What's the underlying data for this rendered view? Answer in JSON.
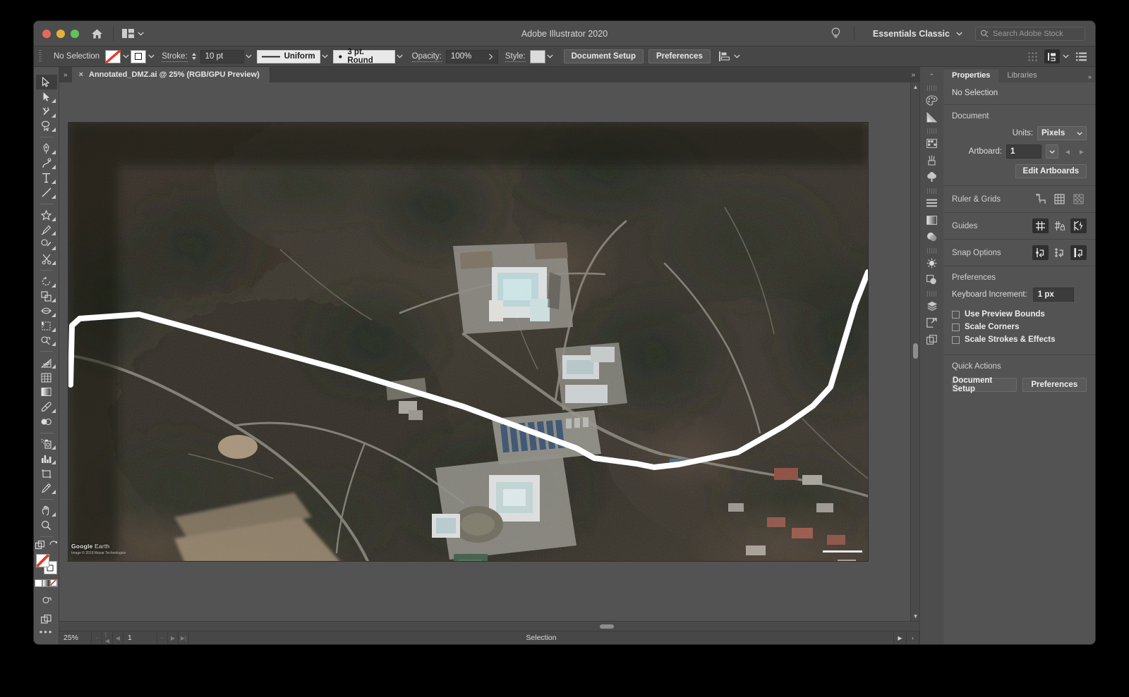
{
  "window": {
    "app_title": "Adobe Illustrator 2020",
    "workspace": "Essentials Classic",
    "search_placeholder": "Search Adobe Stock",
    "traffic_close": "close-window",
    "traffic_min": "minimize-window",
    "traffic_max": "maximize-window"
  },
  "control_bar": {
    "selection_status": "No Selection",
    "stroke_label": "Stroke:",
    "stroke_weight": "10 pt",
    "stroke_profile": "Uniform",
    "brush_definition": "3 pt. Round",
    "opacity_label": "Opacity:",
    "opacity_value": "100%",
    "style_label": "Style:",
    "document_setup": "Document Setup",
    "preferences": "Preferences"
  },
  "tab": {
    "title": "Annotated_DMZ.ai @ 25% (RGB/GPU Preview)",
    "close_glyph": "×"
  },
  "canvas": {
    "watermark_brand": "Google",
    "watermark_suffix": " Earth",
    "watermark_attr": "Image © 2019 Maxar Technologies"
  },
  "status_bar": {
    "zoom": "25%",
    "artboard_number": "1",
    "tool_status": "Selection"
  },
  "properties_panel": {
    "tabs": [
      "Properties",
      "Libraries"
    ],
    "active_tab": "Properties",
    "no_selection": "No Selection",
    "document_header": "Document",
    "units_label": "Units:",
    "units_value": "Pixels",
    "artboard_label": "Artboard:",
    "artboard_value": "1",
    "edit_artboards": "Edit Artboards",
    "ruler_grids_label": "Ruler & Grids",
    "guides_label": "Guides",
    "snap_options_label": "Snap Options",
    "preferences_header": "Preferences",
    "keyboard_increment_label": "Keyboard Increment:",
    "keyboard_increment_value": "1 px",
    "checkboxes": [
      {
        "label": "Use Preview Bounds",
        "checked": false
      },
      {
        "label": "Scale Corners",
        "checked": false
      },
      {
        "label": "Scale Strokes & Effects",
        "checked": false
      }
    ],
    "quick_actions_header": "Quick Actions",
    "quick_actions": [
      "Document Setup",
      "Preferences"
    ]
  },
  "tools": [
    "selection-tool",
    "direct-selection-tool",
    "magic-wand-tool",
    "lasso-tool",
    "pen-tool",
    "curvature-tool",
    "type-tool",
    "line-segment-tool",
    "rectangle-tool",
    "paintbrush-tool",
    "shaper-tool",
    "scissors-tool",
    "rotate-tool",
    "scale-tool",
    "width-tool",
    "free-transform-tool",
    "shape-builder-tool",
    "perspective-grid-tool",
    "mesh-tool",
    "gradient-tool",
    "eyedropper-tool",
    "blend-tool",
    "symbol-sprayer-tool",
    "column-graph-tool",
    "artboard-tool",
    "slice-tool",
    "hand-tool",
    "zoom-tool"
  ],
  "dock_icons": [
    "color-panel-icon",
    "gradient-panel-icon",
    "swatches-panel-icon",
    "brushes-panel-icon",
    "symbols-panel-icon",
    "align-panel-icon",
    "transparency-panel-icon",
    "appearance-panel-icon",
    "stroke-panel-icon",
    "pathfinder-panel-icon",
    "layers-panel-icon",
    "asset-export-panel-icon",
    "artboards-panel-icon"
  ],
  "colors": {
    "chrome": "#535353",
    "chrome_dark": "#474747",
    "accent_red": "#e23b2e",
    "text": "#e4e4e4",
    "annotation_stroke": "#ffffff"
  }
}
